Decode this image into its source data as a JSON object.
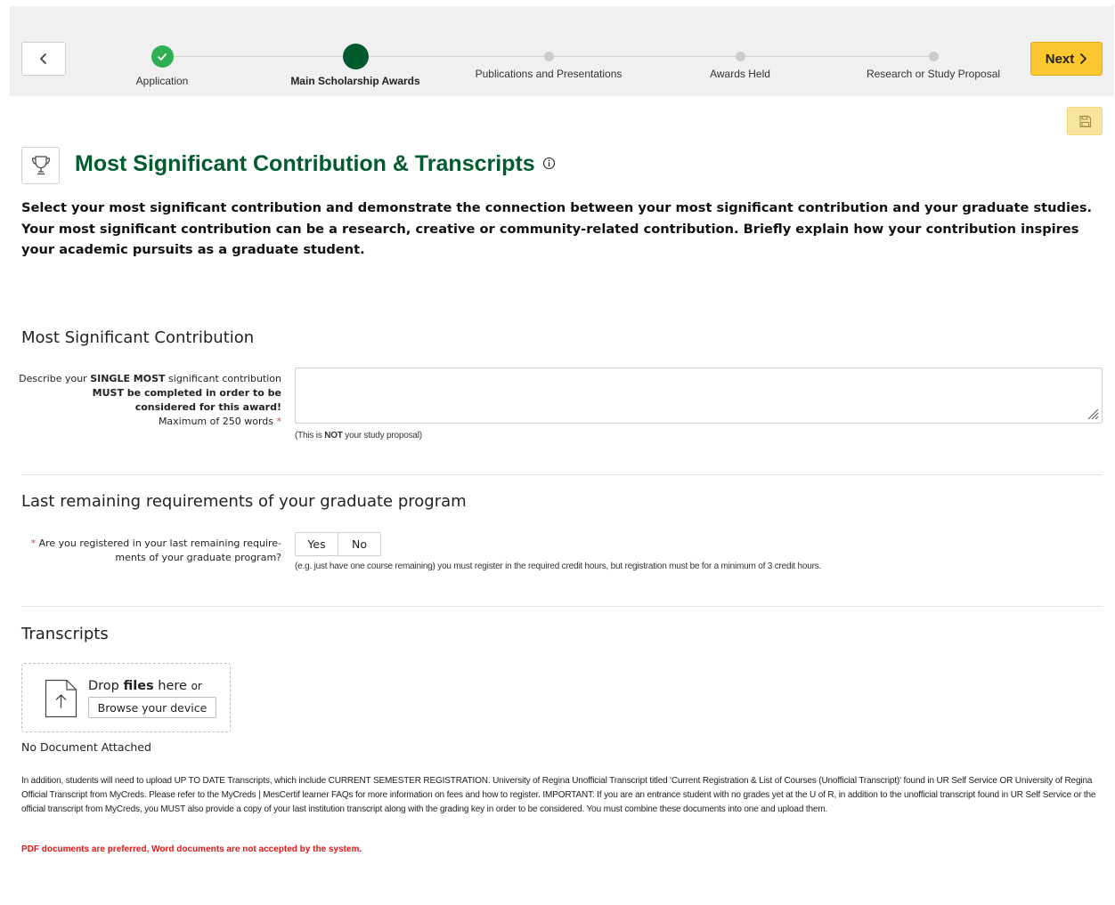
{
  "header": {
    "back_label": "Previous",
    "next_label": "Next",
    "steps": [
      {
        "label": "Application",
        "state": "done"
      },
      {
        "label": "Main Scholarship Awards",
        "state": "current"
      },
      {
        "label": "Publications and Presentations",
        "state": "pending"
      },
      {
        "label": "Awards Held",
        "state": "pending"
      },
      {
        "label": "Research or Study Proposal",
        "state": "pending"
      }
    ]
  },
  "colors": {
    "brand_green": "#005b2e",
    "done_green": "#2eb052",
    "accent_yellow": "#fdc82f",
    "required_red": "#e8412c",
    "warning_red": "#e81414"
  },
  "icons": {
    "back": "chevron-left-icon",
    "next": "chevron-right-icon",
    "save": "floppy-disk-icon",
    "title": "trophy-icon",
    "info": "info-circle-icon",
    "upload": "file-upload-icon",
    "resize": "resize-grip-icon"
  },
  "page": {
    "title": "Most Significant Contribution & Transcripts",
    "intro": "Select your most significant contribution and demonstrate the connection between your most significant contribution and your graduate studies. Your most significant contribution can be a research, creative or community-related contribution. Briefly explain how your contribution inspires your academic pursuits as a graduate student."
  },
  "contribution": {
    "heading": "Most Significant Contribution",
    "label_pre": "Describe your ",
    "label_bold": "SINGLE MOST",
    "label_post": " significant contribution",
    "label_line2": "MUST be completed in order to be considered for this award!",
    "label_line3": "Maximum of 250 words",
    "required_mark": "*",
    "value": "",
    "hint_pre": "(This is ",
    "hint_bold": "NOT",
    "hint_post": " your study proposal)"
  },
  "requirements": {
    "heading": "Last remaining requirements of your graduate program",
    "required_mark": "*",
    "label_line1": "Are you registered in your last remaining require-",
    "label_line2": "ments of your graduate program?",
    "yes_label": "Yes",
    "no_label": "No",
    "hint": "(e.g. just have one course remaining) you must register in the required credit hours, but registration must be for a minimum of 3 credit hours."
  },
  "transcripts": {
    "heading": "Transcripts",
    "drop_pre": "Drop ",
    "drop_bold": "files",
    "drop_post": " here ",
    "drop_or": "or",
    "browse_label": "Browse your device",
    "no_document": "No Document Attached",
    "note": "In addition, students will need to upload UP TO DATE Transcripts, which include CURRENT SEMESTER REGISTRATION. University of Regina Unofficial Transcript titled 'Current Registration & List of Courses (Unofficial Transcript)' found in UR Self Service OR University of Regina Official Transcript from MyCreds. Please refer to the MyCreds | MesCertif learner FAQs for more information on fees and how to register. IMPORTANT: If you are an entrance student with no grades yet at the U of R, in addition to the unofficial transcript found in UR Self Service or the official transcript from MyCreds, you MUST also provide a copy of your last institution transcript along with the grading key in order to be considered. You must combine these documents into one and upload them.",
    "warning": "PDF documents are preferred, Word documents are not accepted by the system."
  }
}
